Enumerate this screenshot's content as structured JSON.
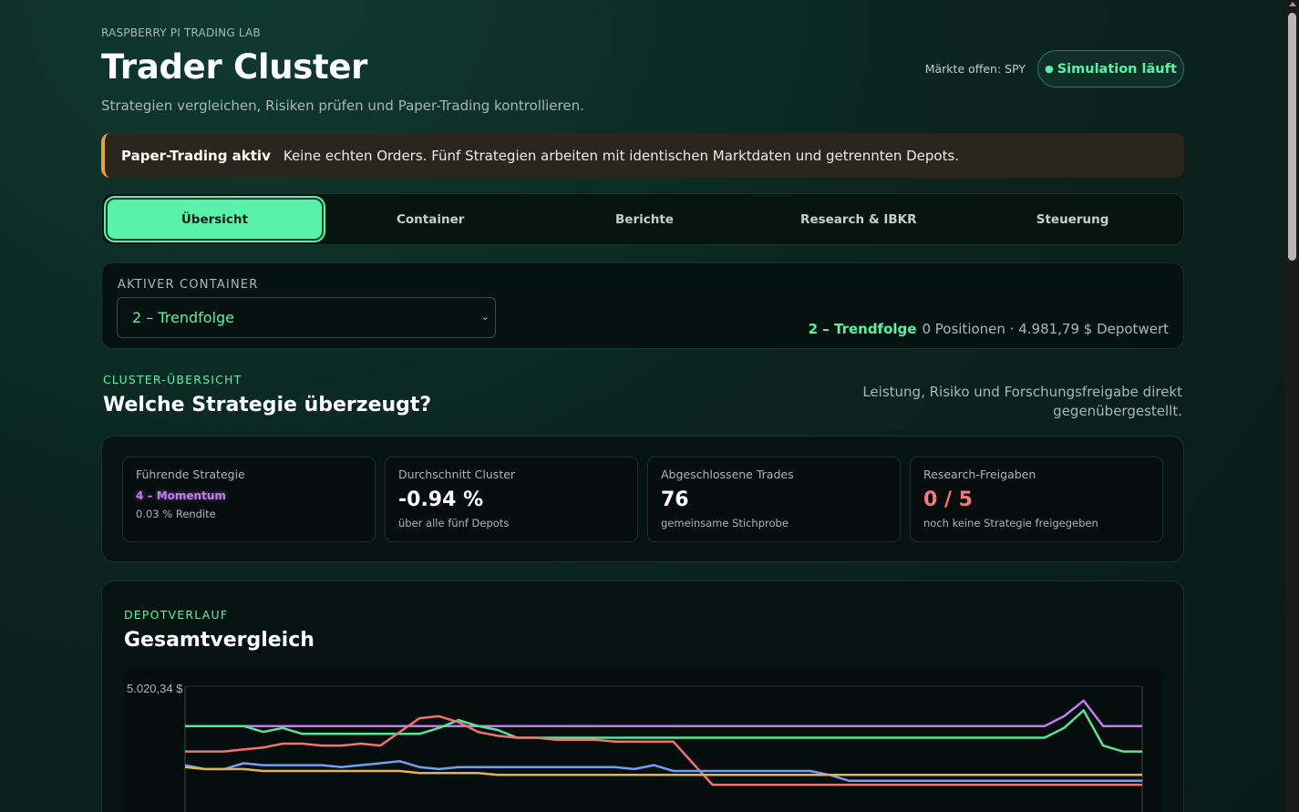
{
  "header": {
    "eyebrow": "RASPBERRY PI TRADING LAB",
    "title": "Trader Cluster",
    "subtitle": "Strategien vergleichen, Risiken prüfen und Paper-Trading kontrollieren.",
    "market_status": "Märkte offen: SPY",
    "sim_status": "Simulation läuft",
    "sim_dot": "●"
  },
  "banner": {
    "label": "Paper-Trading aktiv",
    "text": "Keine echten Orders. Fünf Strategien arbeiten mit identischen Marktdaten und getrennten Depots."
  },
  "tabs": [
    {
      "label": "Übersicht",
      "active": true
    },
    {
      "label": "Container",
      "active": false
    },
    {
      "label": "Berichte",
      "active": false
    },
    {
      "label": "Research & IBKR",
      "active": false
    },
    {
      "label": "Steuerung",
      "active": false
    }
  ],
  "container": {
    "label": "AKTIVER CONTAINER",
    "selected": "2 – Trendfolge",
    "info_name": "2 – Trendfolge",
    "info_text": "0 Positionen · 4.981,79 $ Depotwert"
  },
  "overview": {
    "eyebrow": "CLUSTER-ÜBERSICHT",
    "title": "Welche Strategie überzeugt?",
    "note": "Leistung, Risiko und Forschungsfreigabe direkt gegenübergestellt."
  },
  "cards": [
    {
      "label": "Führende Strategie",
      "value": "4 – Momentum",
      "sub": "0.03 % Rendite"
    },
    {
      "label": "Durchschnitt Cluster",
      "value": "-0.94 %",
      "sub": "über alle fünf Depots"
    },
    {
      "label": "Abgeschlossene Trades",
      "value": "76",
      "sub": "gemeinsame Stichprobe"
    },
    {
      "label": "Research-Freigaben",
      "value": "0 / 5",
      "sub": "noch keine Strategie freigegeben"
    }
  ],
  "chart_section": {
    "eyebrow": "DEPOTVERLAUF",
    "title": "Gesamtvergleich"
  },
  "chart_data": {
    "type": "line",
    "title": "",
    "xlabel": "",
    "ylabel": "",
    "y_top_label": "5.020,34 $",
    "ymax": 5020.34,
    "grid": false,
    "series": [
      {
        "color": "#c67af2",
        "values": [
          5000,
          5000,
          5000,
          5000,
          5000,
          5000,
          5000,
          5000,
          5000,
          5000,
          5000,
          5000,
          5000,
          5000,
          5000,
          5000,
          5000,
          5000,
          5000,
          5000,
          5000,
          5000,
          5000,
          5000,
          5000,
          5000,
          5000,
          5000,
          5000,
          5000,
          5000,
          5000,
          5000,
          5000,
          5000,
          5000,
          5000,
          5000,
          5000,
          5000,
          5000,
          5000,
          5000,
          5000,
          5000,
          5005,
          5013,
          5000,
          5000,
          5000
        ]
      },
      {
        "color": "#58e29a",
        "values": [
          5000,
          5000,
          5000,
          5000,
          4997,
          4999,
          4996,
          4996,
          4996,
          4996,
          4996,
          4996,
          4996,
          4999,
          5003,
          5000,
          4998,
          4994,
          4994,
          4994,
          4994,
          4994,
          4994,
          4994,
          4994,
          4994,
          4994,
          4994,
          4994,
          4994,
          4994,
          4994,
          4994,
          4994,
          4994,
          4994,
          4994,
          4994,
          4994,
          4994,
          4994,
          4994,
          4994,
          4994,
          4994,
          4999,
          5008,
          4990,
          4987,
          4987
        ]
      },
      {
        "color": "#ef7373",
        "values": [
          4987,
          4987,
          4987,
          4988,
          4989,
          4991,
          4991,
          4990,
          4990,
          4991,
          4990,
          4997,
          5004,
          5005,
          5002,
          4997,
          4995,
          4994,
          4994,
          4993,
          4993,
          4993,
          4992,
          4992,
          4992,
          4992,
          4981,
          4970,
          4970,
          4970,
          4970,
          4970,
          4970,
          4970,
          4970,
          4970,
          4970,
          4970,
          4970,
          4970,
          4970,
          4970,
          4970,
          4970,
          4970,
          4970,
          4970,
          4970,
          4970,
          4970
        ]
      },
      {
        "color": "#6fa0f2",
        "values": [
          4980,
          4978,
          4978,
          4981,
          4980,
          4980,
          4980,
          4980,
          4979,
          4980,
          4981,
          4982,
          4979,
          4978,
          4979,
          4979,
          4979,
          4979,
          4979,
          4979,
          4979,
          4979,
          4979,
          4978,
          4980,
          4977,
          4977,
          4977,
          4977,
          4977,
          4977,
          4977,
          4977,
          4975,
          4972,
          4972,
          4972,
          4972,
          4972,
          4972,
          4972,
          4972,
          4972,
          4972,
          4972,
          4972,
          4972,
          4972,
          4972,
          4972
        ]
      },
      {
        "color": "#e2b54a",
        "values": [
          4979,
          4978,
          4978,
          4978,
          4977,
          4977,
          4977,
          4977,
          4977,
          4977,
          4977,
          4977,
          4976,
          4976,
          4976,
          4976,
          4975,
          4975,
          4975,
          4975,
          4975,
          4975,
          4975,
          4975,
          4975,
          4975,
          4975,
          4975,
          4975,
          4975,
          4975,
          4975,
          4975,
          4975,
          4975,
          4975,
          4975,
          4975,
          4975,
          4975,
          4975,
          4975,
          4975,
          4975,
          4975,
          4975,
          4975,
          4975,
          4975,
          4975
        ]
      }
    ]
  }
}
